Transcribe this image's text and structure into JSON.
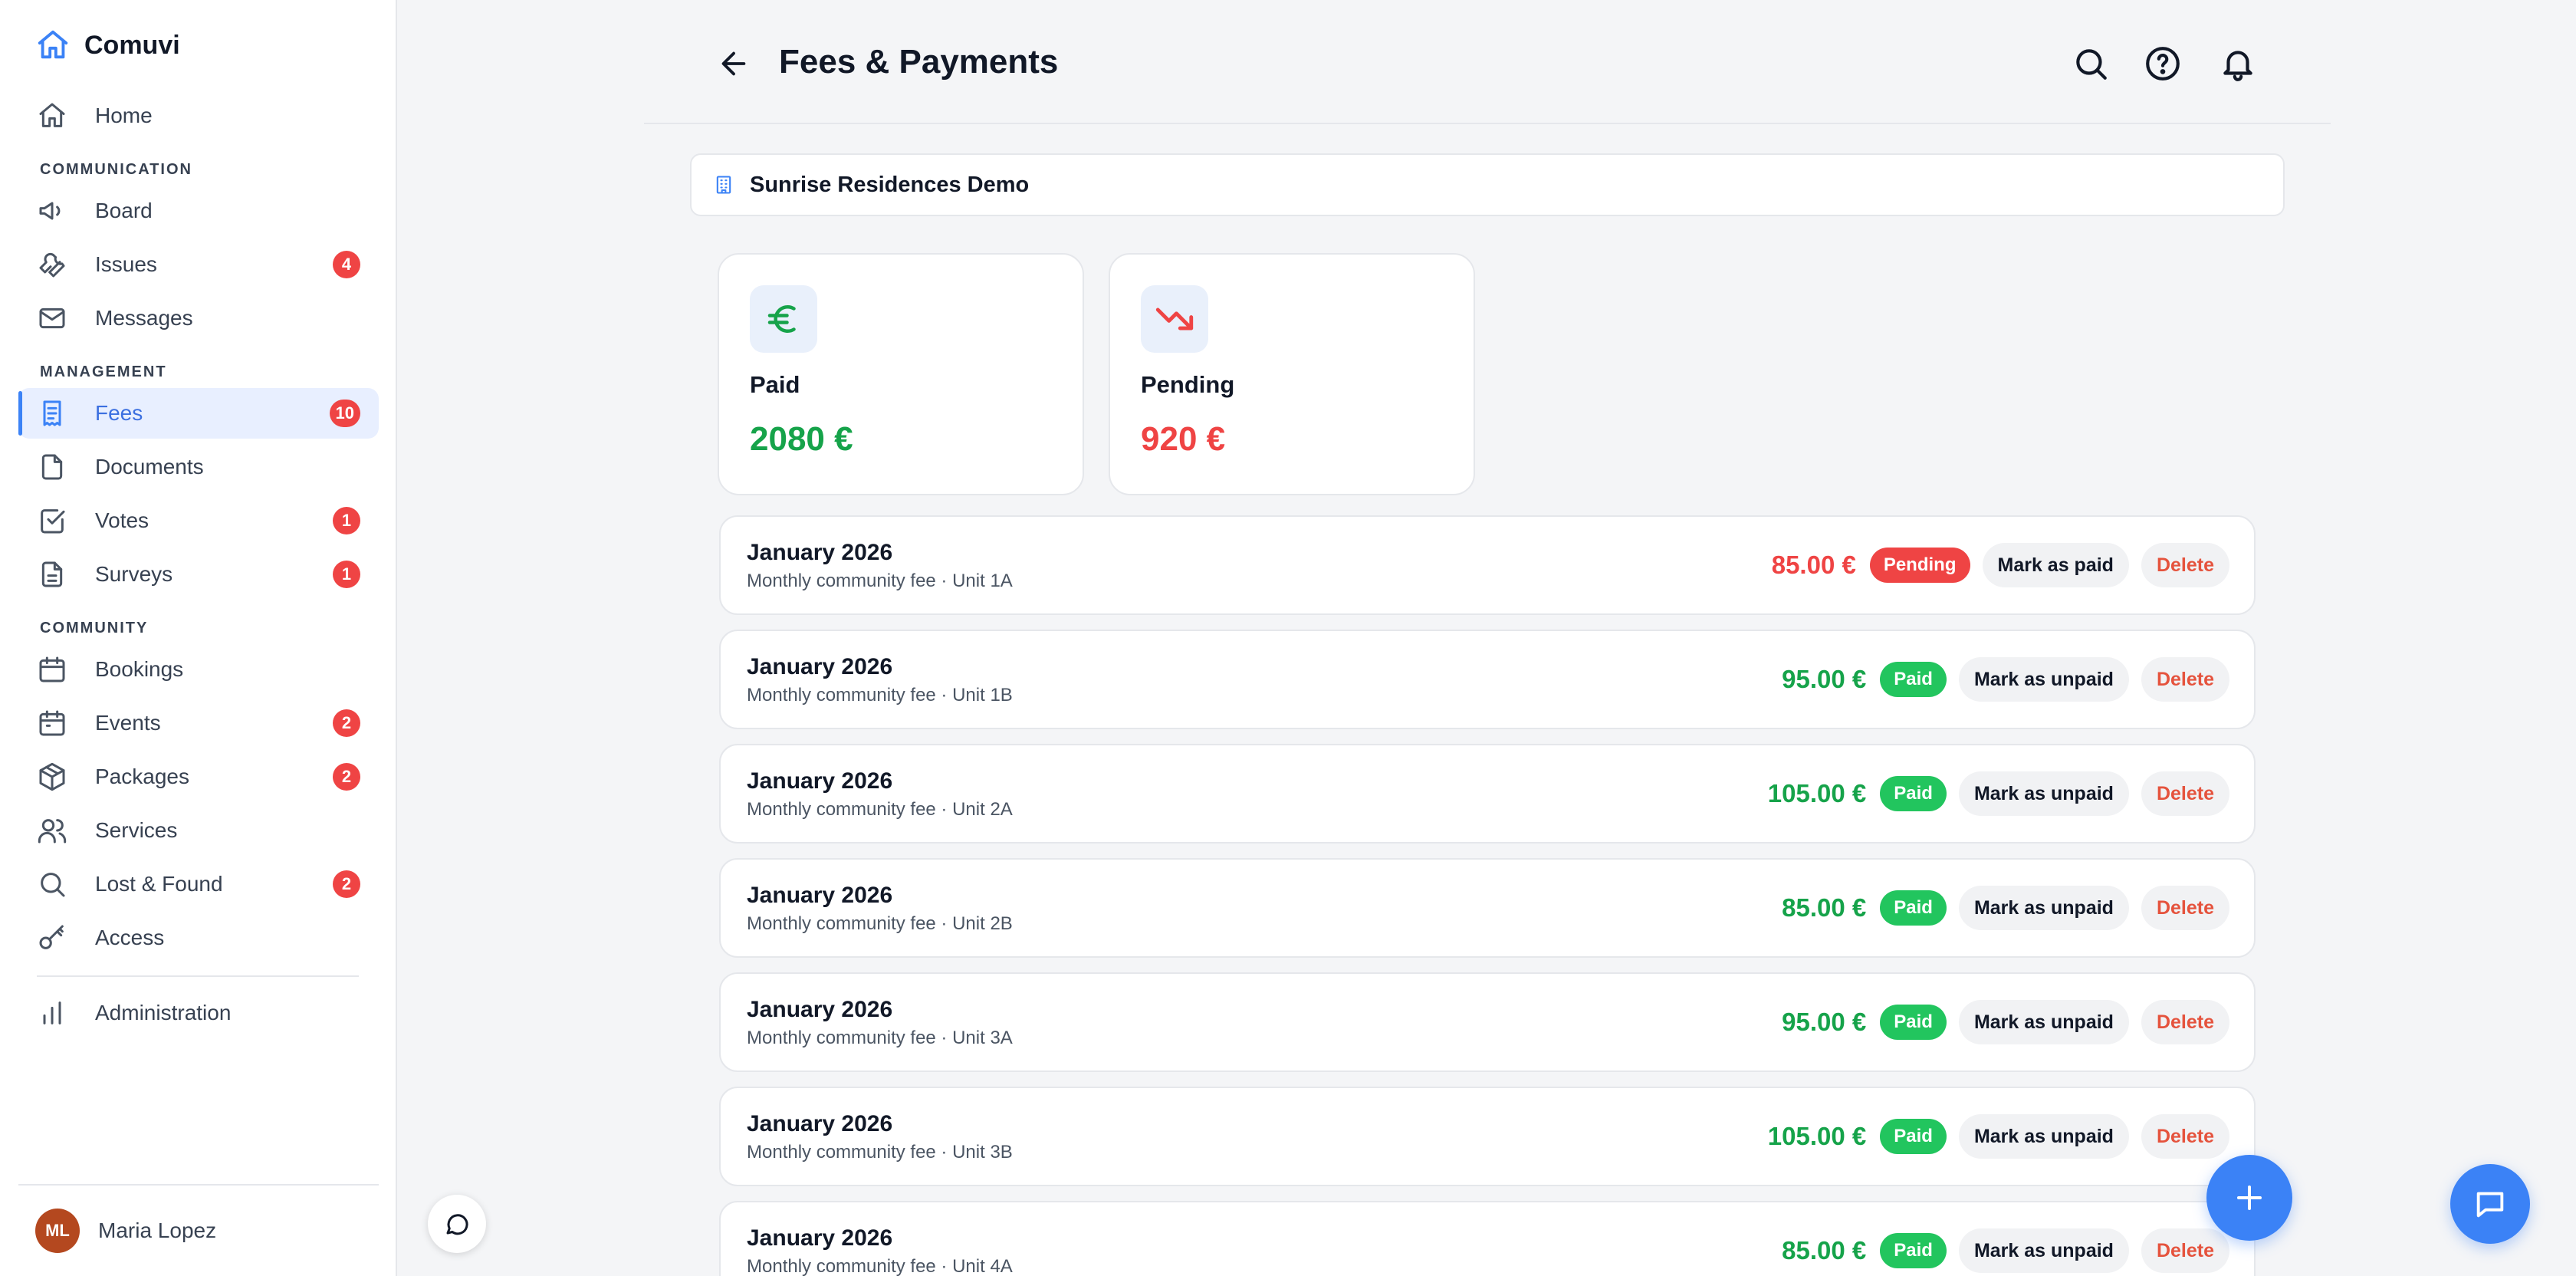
{
  "app": {
    "name": "Comuvi"
  },
  "sidebar": {
    "sections": [
      "COMMUNICATION",
      "MANAGEMENT",
      "COMMUNITY"
    ],
    "items": [
      {
        "label": "Home",
        "icon": "home-icon"
      },
      {
        "label": "Board",
        "icon": "megaphone-icon"
      },
      {
        "label": "Issues",
        "icon": "wrench-icon",
        "badge": "4"
      },
      {
        "label": "Messages",
        "icon": "mail-icon"
      },
      {
        "label": "Fees",
        "icon": "receipt-icon",
        "badge": "10",
        "active": true
      },
      {
        "label": "Documents",
        "icon": "file-icon"
      },
      {
        "label": "Votes",
        "icon": "checkbox-icon",
        "badge": "1"
      },
      {
        "label": "Surveys",
        "icon": "clipboard-icon",
        "badge": "1"
      },
      {
        "label": "Bookings",
        "icon": "calendar-icon"
      },
      {
        "label": "Events",
        "icon": "calendar-event-icon",
        "badge": "2"
      },
      {
        "label": "Packages",
        "icon": "package-icon",
        "badge": "2"
      },
      {
        "label": "Services",
        "icon": "users-icon"
      },
      {
        "label": "Lost & Found",
        "icon": "search-icon",
        "badge": "2"
      },
      {
        "label": "Access",
        "icon": "key-icon"
      },
      {
        "label": "Administration",
        "icon": "bar-chart-icon"
      }
    ],
    "user": {
      "initials": "ML",
      "name": "Maria Lopez"
    }
  },
  "header": {
    "title": "Fees & Payments"
  },
  "community": {
    "name": "Sunrise Residences Demo"
  },
  "stats": {
    "paid": {
      "label": "Paid",
      "value": "2080 €"
    },
    "pending": {
      "label": "Pending",
      "value": "920 €"
    }
  },
  "fees": [
    {
      "title": "January 2026",
      "subtitle": "Monthly community fee · Unit 1A",
      "amount": "85.00 €",
      "status": "Pending",
      "toggle": "Mark as paid",
      "delete": "Delete"
    },
    {
      "title": "January 2026",
      "subtitle": "Monthly community fee · Unit 1B",
      "amount": "95.00 €",
      "status": "Paid",
      "toggle": "Mark as unpaid",
      "delete": "Delete"
    },
    {
      "title": "January 2026",
      "subtitle": "Monthly community fee · Unit 2A",
      "amount": "105.00 €",
      "status": "Paid",
      "toggle": "Mark as unpaid",
      "delete": "Delete"
    },
    {
      "title": "January 2026",
      "subtitle": "Monthly community fee · Unit 2B",
      "amount": "85.00 €",
      "status": "Paid",
      "toggle": "Mark as unpaid",
      "delete": "Delete"
    },
    {
      "title": "January 2026",
      "subtitle": "Monthly community fee · Unit 3A",
      "amount": "95.00 €",
      "status": "Paid",
      "toggle": "Mark as unpaid",
      "delete": "Delete"
    },
    {
      "title": "January 2026",
      "subtitle": "Monthly community fee · Unit 3B",
      "amount": "105.00 €",
      "status": "Paid",
      "toggle": "Mark as unpaid",
      "delete": "Delete"
    },
    {
      "title": "January 2026",
      "subtitle": "Monthly community fee · Unit 4A",
      "amount": "85.00 €",
      "status": "Paid",
      "toggle": "Mark as unpaid",
      "delete": "Delete"
    }
  ],
  "colors": {
    "accent": "#3b82f6",
    "paid": "#16a34a",
    "paid_pill": "#22c55e",
    "pending": "#ef4444",
    "delete": "#e5533d"
  }
}
